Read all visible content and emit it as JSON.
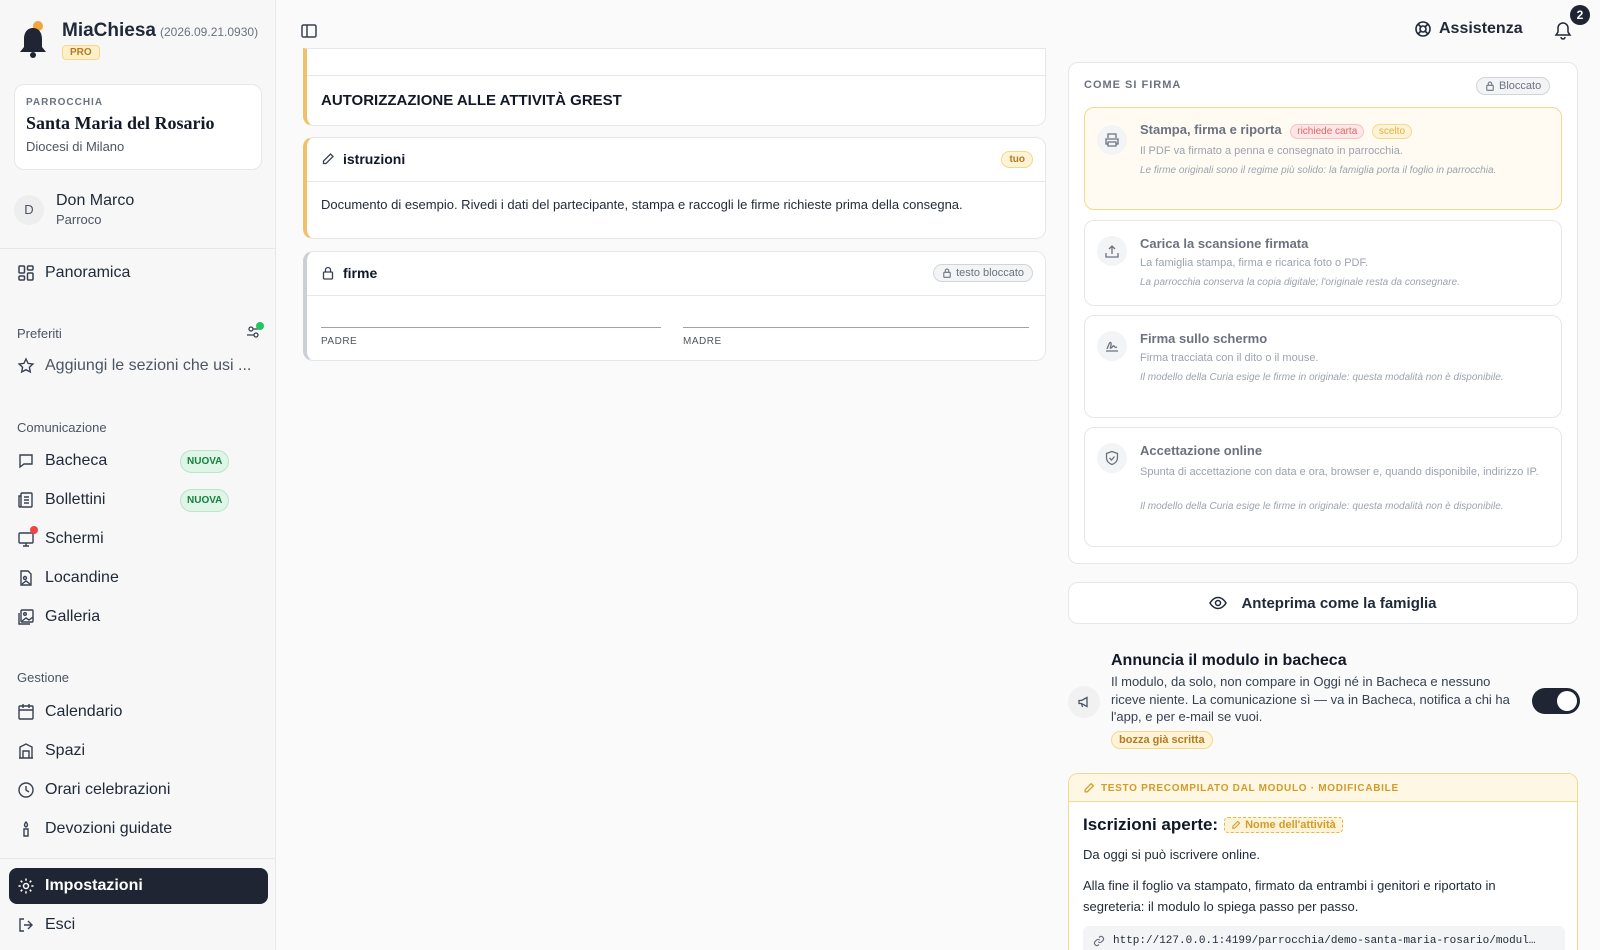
{
  "app": {
    "name": "MiaChiesa",
    "version": "(2026.09.21.0930)",
    "plan": "PRO"
  },
  "parish": {
    "kicker": "PARROCCHIA",
    "name": "Santa Maria del Rosario",
    "diocese": "Diocesi di Milano"
  },
  "user": {
    "initial": "D",
    "name": "Don Marco",
    "role": "Parroco"
  },
  "nav": {
    "overview": "Panoramica",
    "favorites_section": "Preferiti",
    "favorites_add": "Aggiungi le sezioni che usi ...",
    "communication_section": "Comunicazione",
    "bacheca": "Bacheca",
    "bollettini": "Bollettini",
    "new_badge": "NUOVA",
    "schermi": "Schermi",
    "locandine": "Locandine",
    "galleria": "Galleria",
    "management_section": "Gestione",
    "calendario": "Calendario",
    "spazi": "Spazi",
    "orari": "Orari celebrazioni",
    "devozioni": "Devozioni guidate",
    "impostazioni": "Impostazioni",
    "esci": "Esci"
  },
  "topbar": {
    "help": "Assistenza",
    "notifications_count": "2"
  },
  "document": {
    "title": "AUTORIZZAZIONE ALLE ATTIVITÀ GREST",
    "instructions_label": "istruzioni",
    "instructions_tag": "tuo",
    "instructions_text": "Documento di esempio. Rivedi i dati del partecipante, stampa e raccogli le firme richieste prima della consegna.",
    "signatures_label": "firme",
    "signatures_tag": "testo bloccato",
    "sig_father": "PADRE",
    "sig_mother": "MADRE"
  },
  "signing": {
    "heading": "COME SI FIRMA",
    "locked": "Bloccato",
    "options": [
      {
        "title": "Stampa, firma e riporta",
        "tag_paper": "richiede carta",
        "tag_chosen": "scelto",
        "subtitle": "Il PDF va firmato a penna e consegnato in parrocchia.",
        "note": "Le firme originali sono il regime più solido: la famiglia porta il foglio in parrocchia."
      },
      {
        "title": "Carica la scansione firmata",
        "subtitle": "La famiglia stampa, firma e ricarica foto o PDF.",
        "note": "La parrocchia conserva la copia digitale; l'originale resta da consegnare."
      },
      {
        "title": "Firma sullo schermo",
        "subtitle": "Firma tracciata con il dito o il mouse.",
        "note": "Il modello della Curia esige le firme in originale: questa modalità non è disponibile."
      },
      {
        "title": "Accettazione online",
        "subtitle": "Spunta di accettazione con data e ora, browser e, quando disponibile, indirizzo IP.",
        "note": "Il modello della Curia esige le firme in originale: questa modalità non è disponibile."
      }
    ],
    "preview_button": "Anteprima come la famiglia"
  },
  "announce": {
    "title": "Annuncia il modulo in bacheca",
    "text": "Il modulo, da solo, non compare in Oggi né in Bacheca e nessuno riceve niente. La comunicazione sì — va in Bacheca, notifica a chi ha l'app, e per e-mail se vuoi.",
    "draft_tag": "bozza già scritta",
    "toggle_on": true
  },
  "prefilled": {
    "heading": "TESTO PRECOMPILATO DAL MODULO · MODIFICABILE",
    "title": "Iscrizioni aperte:",
    "placeholder_chip": "Nome dell'attività",
    "line1": "Da oggi si può iscrivere online.",
    "line2": "Alla fine il foglio va stampato, firmato da entrambi i genitori e riportato in segreteria: il modulo lo spiega passo per passo.",
    "link": "http://127.0.0.1:4199/parrocchia/demo-santa-maria-rosario/modul…"
  },
  "colors": {
    "accent": "#f0c16b",
    "active_nav": "#1f2533",
    "toggle": "#1f2533",
    "new_badge": "#15803d"
  }
}
